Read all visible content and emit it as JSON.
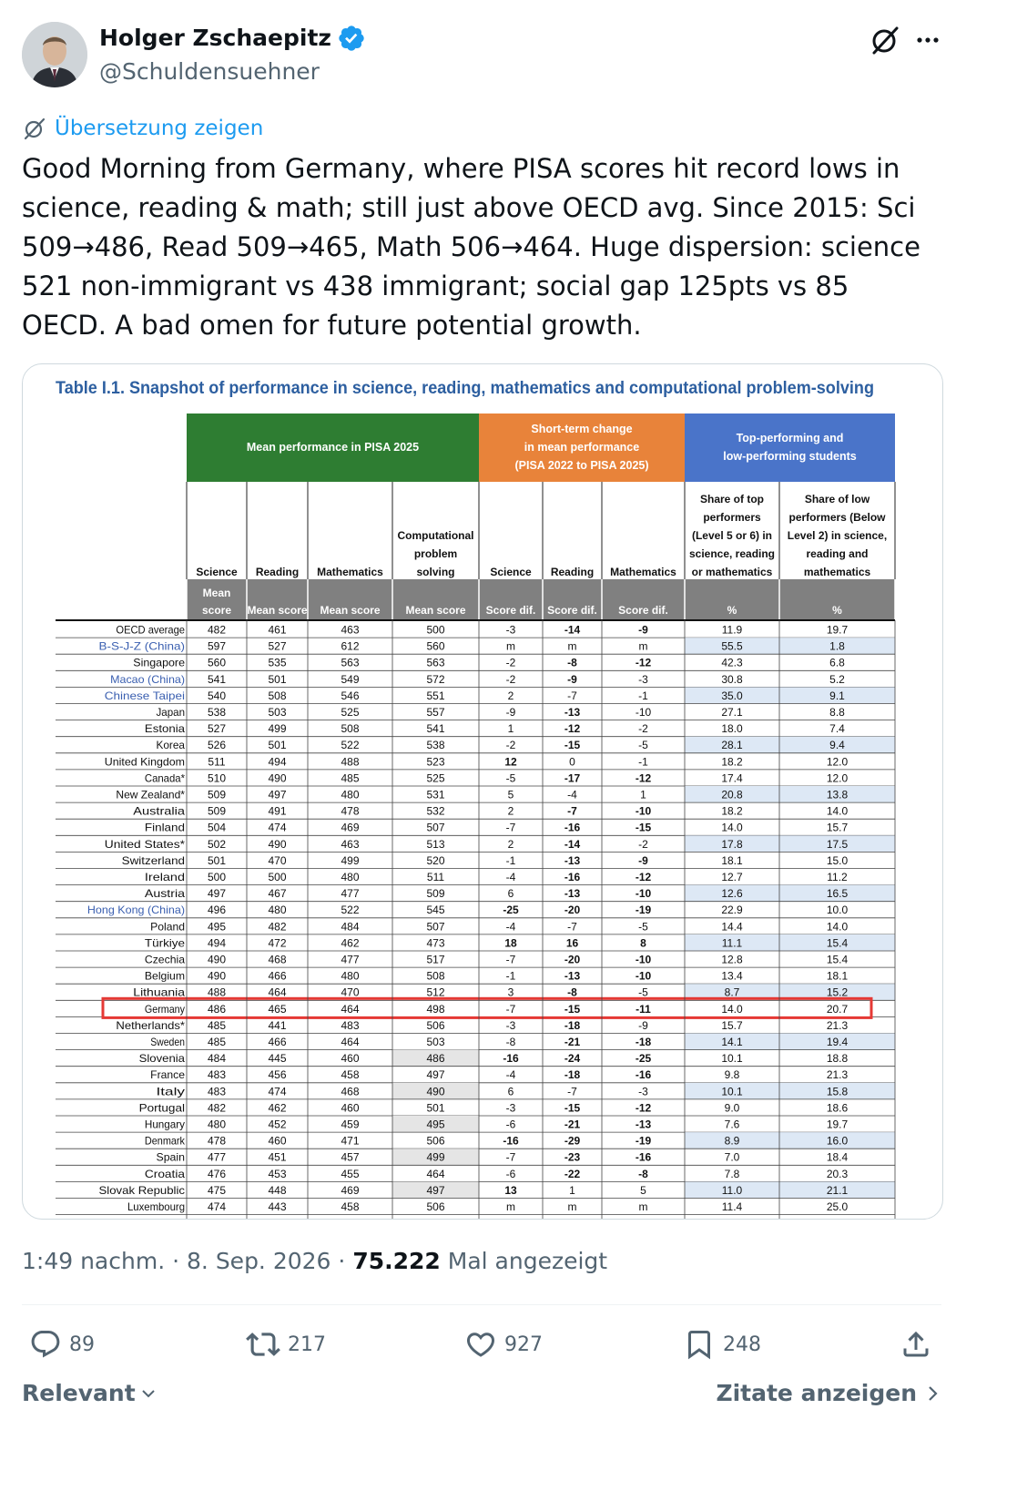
{
  "author": {
    "name": "Holger Zschaepitz",
    "handle": "@Schuldensuehner"
  },
  "translate_label": "Übersetzung zeigen",
  "tweet_text": "Good Morning from Germany, where PISA scores hit record lows in science, reading & math; still just above OECD avg. Since 2015: Sci 509→486, Read 509→465, Math 506→464. Huge dispersion: science 521 non-immigrant vs 438 immigrant; social gap 125pts vs 85 OECD. A bad omen for future potential growth.",
  "table": {
    "title": "Table I.1. Snapshot of performance in science, reading, mathematics and computational problem-solving",
    "group_headers": [
      [
        "Mean performance in PISA 2025"
      ],
      [
        "Short-term change",
        "in mean performance",
        "(PISA 2022 to PISA 2025)"
      ],
      [
        "Top-performing and",
        "low-performing students"
      ]
    ],
    "col_headers": [
      [
        "Science"
      ],
      [
        "Reading"
      ],
      [
        "Mathematics"
      ],
      [
        "Computational",
        "problem",
        "solving"
      ],
      [
        "Science"
      ],
      [
        "Reading"
      ],
      [
        "Mathematics"
      ],
      [
        "Share of top",
        "performers",
        "(Level 5 or 6) in",
        "science, reading",
        "or mathematics"
      ],
      [
        "Share of low",
        "performers (Below",
        "Level 2) in science,",
        "reading and",
        "mathematics"
      ]
    ],
    "sub_headers": [
      [
        "Mean",
        "score"
      ],
      [
        "Mean score"
      ],
      [
        "Mean score"
      ],
      [
        "Mean score"
      ],
      [
        "Score dif."
      ],
      [
        "Score dif."
      ],
      [
        "Score dif."
      ],
      [
        "%"
      ],
      [
        "%"
      ]
    ],
    "colors": {
      "green": "#2e7d32",
      "orange": "#e8833a",
      "blue": "#4a74c9",
      "sub": "#808080",
      "title": "#2d5fa0",
      "link": "#3a5fb0",
      "highlight": "#e53935",
      "shade_blue": "#dde8f5",
      "shade_gray": "#e5e5e5"
    },
    "rows": [
      {
        "country": "OECD average",
        "link": false,
        "sup": false,
        "v": [
          "482",
          "461",
          "463",
          "500",
          "-3",
          "-14",
          "-9",
          "11.9",
          "19.7"
        ],
        "bold": [
          5,
          6
        ]
      },
      {
        "country": "B-S-J-Z (China)",
        "link": true,
        "sup": false,
        "v": [
          "597",
          "527",
          "612",
          "560",
          "m",
          "m",
          "m",
          "55.5",
          "1.8"
        ],
        "bold": []
      },
      {
        "country": "Singapore",
        "link": false,
        "sup": false,
        "v": [
          "560",
          "535",
          "563",
          "563",
          "-2",
          "-8",
          "-12",
          "42.3",
          "6.8"
        ],
        "bold": [
          5,
          6
        ]
      },
      {
        "country": "Macao (China)",
        "link": true,
        "sup": false,
        "v": [
          "541",
          "501",
          "549",
          "572",
          "-2",
          "-9",
          "-3",
          "30.8",
          "5.2"
        ],
        "bold": [
          5
        ]
      },
      {
        "country": "Chinese Taipei",
        "link": true,
        "sup": false,
        "v": [
          "540",
          "508",
          "546",
          "551",
          "2",
          "-7",
          "-1",
          "35.0",
          "9.1"
        ],
        "bold": []
      },
      {
        "country": "Japan",
        "link": false,
        "sup": false,
        "v": [
          "538",
          "503",
          "525",
          "557",
          "-9",
          "-13",
          "-10",
          "27.1",
          "8.8"
        ],
        "bold": [
          5
        ]
      },
      {
        "country": "Estonia",
        "link": false,
        "sup": false,
        "v": [
          "527",
          "499",
          "508",
          "541",
          "1",
          "-12",
          "-2",
          "18.0",
          "7.4"
        ],
        "bold": [
          5
        ]
      },
      {
        "country": "Korea",
        "link": false,
        "sup": false,
        "v": [
          "526",
          "501",
          "522",
          "538",
          "-2",
          "-15",
          "-5",
          "28.1",
          "9.4"
        ],
        "bold": [
          5
        ]
      },
      {
        "country": "United Kingdom",
        "link": false,
        "sup": false,
        "v": [
          "511",
          "494",
          "488",
          "523",
          "12",
          "0",
          "-1",
          "18.2",
          "12.0"
        ],
        "bold": [
          4
        ]
      },
      {
        "country": "Canada",
        "link": false,
        "sup": true,
        "v": [
          "510",
          "490",
          "485",
          "525",
          "-5",
          "-17",
          "-12",
          "17.4",
          "12.0"
        ],
        "bold": [
          5,
          6
        ]
      },
      {
        "country": "New Zealand",
        "link": false,
        "sup": true,
        "v": [
          "509",
          "497",
          "480",
          "531",
          "5",
          "-4",
          "1",
          "20.8",
          "13.8"
        ],
        "bold": []
      },
      {
        "country": "Australia",
        "link": false,
        "sup": false,
        "v": [
          "509",
          "491",
          "478",
          "532",
          "2",
          "-7",
          "-10",
          "18.2",
          "14.0"
        ],
        "bold": [
          5,
          6
        ]
      },
      {
        "country": "Finland",
        "link": false,
        "sup": false,
        "v": [
          "504",
          "474",
          "469",
          "507",
          "-7",
          "-16",
          "-15",
          "14.0",
          "15.7"
        ],
        "bold": [
          5,
          6
        ]
      },
      {
        "country": "United States",
        "link": false,
        "sup": true,
        "v": [
          "502",
          "490",
          "463",
          "513",
          "2",
          "-14",
          "-2",
          "17.8",
          "17.5"
        ],
        "bold": [
          5
        ]
      },
      {
        "country": "Switzerland",
        "link": false,
        "sup": false,
        "v": [
          "501",
          "470",
          "499",
          "520",
          "-1",
          "-13",
          "-9",
          "18.1",
          "15.0"
        ],
        "bold": [
          5,
          6
        ]
      },
      {
        "country": "Ireland",
        "link": false,
        "sup": false,
        "v": [
          "500",
          "500",
          "480",
          "511",
          "-4",
          "-16",
          "-12",
          "12.7",
          "11.2"
        ],
        "bold": [
          5,
          6
        ]
      },
      {
        "country": "Austria",
        "link": false,
        "sup": false,
        "v": [
          "497",
          "467",
          "477",
          "509",
          "6",
          "-13",
          "-10",
          "12.6",
          "16.5"
        ],
        "bold": [
          5,
          6
        ]
      },
      {
        "country": "Hong Kong (China)",
        "link": true,
        "sup": false,
        "v": [
          "496",
          "480",
          "522",
          "545",
          "-25",
          "-20",
          "-19",
          "22.9",
          "10.0"
        ],
        "bold": [
          4,
          5,
          6
        ]
      },
      {
        "country": "Poland",
        "link": false,
        "sup": false,
        "v": [
          "495",
          "482",
          "484",
          "507",
          "-4",
          "-7",
          "-5",
          "14.4",
          "14.0"
        ],
        "bold": []
      },
      {
        "country": "Türkiye",
        "link": false,
        "sup": false,
        "v": [
          "494",
          "472",
          "462",
          "473",
          "18",
          "16",
          "8",
          "11.1",
          "15.4"
        ],
        "bold": [
          4,
          5,
          6
        ]
      },
      {
        "country": "Czechia",
        "link": false,
        "sup": false,
        "v": [
          "490",
          "468",
          "477",
          "517",
          "-7",
          "-20",
          "-10",
          "12.8",
          "15.4"
        ],
        "bold": [
          5,
          6
        ]
      },
      {
        "country": "Belgium",
        "link": false,
        "sup": false,
        "v": [
          "490",
          "466",
          "480",
          "508",
          "-1",
          "-13",
          "-10",
          "13.4",
          "18.1"
        ],
        "bold": [
          5,
          6
        ]
      },
      {
        "country": "Lithuania",
        "link": false,
        "sup": false,
        "v": [
          "488",
          "464",
          "470",
          "512",
          "3",
          "-8",
          "-5",
          "8.7",
          "15.2"
        ],
        "bold": [
          5
        ]
      },
      {
        "country": "Germany",
        "link": false,
        "sup": false,
        "v": [
          "486",
          "465",
          "464",
          "498",
          "-7",
          "-15",
          "-11",
          "14.0",
          "20.7"
        ],
        "bold": [
          5,
          6
        ],
        "highlight": true
      },
      {
        "country": "Netherlands",
        "link": false,
        "sup": true,
        "v": [
          "485",
          "441",
          "483",
          "506",
          "-3",
          "-18",
          "-9",
          "15.7",
          "21.3"
        ],
        "bold": [
          5
        ]
      },
      {
        "country": "Sweden",
        "link": false,
        "sup": false,
        "v": [
          "485",
          "466",
          "464",
          "503",
          "-8",
          "-21",
          "-18",
          "14.1",
          "19.4"
        ],
        "bold": [
          5,
          6
        ]
      },
      {
        "country": "Slovenia",
        "link": false,
        "sup": false,
        "v": [
          "484",
          "445",
          "460",
          "486",
          "-16",
          "-24",
          "-25",
          "10.1",
          "18.8"
        ],
        "bold": [
          4,
          5,
          6
        ]
      },
      {
        "country": "France",
        "link": false,
        "sup": false,
        "v": [
          "483",
          "456",
          "458",
          "497",
          "-4",
          "-18",
          "-16",
          "9.8",
          "21.3"
        ],
        "bold": [
          5,
          6
        ]
      },
      {
        "country": "Italy",
        "link": false,
        "sup": false,
        "v": [
          "483",
          "474",
          "468",
          "490",
          "6",
          "-7",
          "-3",
          "10.1",
          "15.8"
        ],
        "bold": []
      },
      {
        "country": "Portugal",
        "link": false,
        "sup": false,
        "v": [
          "482",
          "462",
          "460",
          "501",
          "-3",
          "-15",
          "-12",
          "9.0",
          "18.6"
        ],
        "bold": [
          5,
          6
        ]
      },
      {
        "country": "Hungary",
        "link": false,
        "sup": false,
        "v": [
          "480",
          "452",
          "459",
          "495",
          "-6",
          "-21",
          "-13",
          "7.6",
          "19.7"
        ],
        "bold": [
          5,
          6
        ]
      },
      {
        "country": "Denmark",
        "link": false,
        "sup": false,
        "v": [
          "478",
          "460",
          "471",
          "506",
          "-16",
          "-29",
          "-19",
          "8.9",
          "16.0"
        ],
        "bold": [
          4,
          5,
          6
        ]
      },
      {
        "country": "Spain",
        "link": false,
        "sup": false,
        "v": [
          "477",
          "451",
          "457",
          "499",
          "-7",
          "-23",
          "-16",
          "7.0",
          "18.4"
        ],
        "bold": [
          5,
          6
        ]
      },
      {
        "country": "Croatia",
        "link": false,
        "sup": false,
        "v": [
          "476",
          "453",
          "455",
          "464",
          "-6",
          "-22",
          "-8",
          "7.8",
          "20.3"
        ],
        "bold": [
          5,
          6
        ]
      },
      {
        "country": "Slovak Republic",
        "link": false,
        "sup": false,
        "v": [
          "475",
          "448",
          "469",
          "497",
          "13",
          "1",
          "5",
          "11.0",
          "21.1"
        ],
        "bold": [
          4
        ]
      },
      {
        "country": "Luxembourg",
        "link": false,
        "sup": false,
        "v": [
          "474",
          "443",
          "458",
          "506",
          "m",
          "m",
          "m",
          "11.4",
          "25.0"
        ],
        "bold": []
      }
    ]
  },
  "meta": {
    "time": "1:49 nachm.",
    "sep1": "·",
    "date": "8. Sep. 2026",
    "sep2": "·",
    "views": "75.222",
    "views_label": "Mal angezeigt"
  },
  "actions": {
    "replies": "89",
    "reposts": "217",
    "likes": "927",
    "bookmarks": "248"
  },
  "footer": {
    "sort": "Relevant",
    "quotes": "Zitate anzeigen"
  }
}
